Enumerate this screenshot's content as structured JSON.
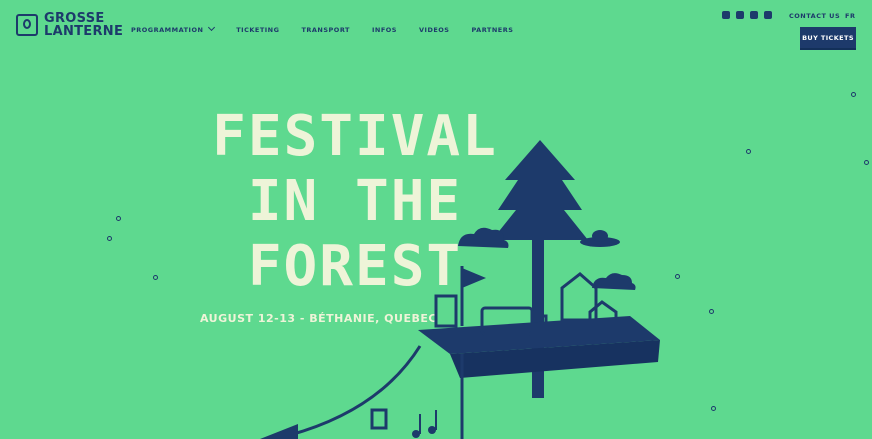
{
  "brand": {
    "line1": "GROSSE",
    "line2": "LANTERNE"
  },
  "nav": {
    "items": [
      "PROGRAMMATION",
      "TICKETING",
      "TRANSPORT",
      "INFOS",
      "VIDEOS",
      "PARTNERS"
    ]
  },
  "header": {
    "social_icons": [
      "twitter-icon",
      "youtube-icon",
      "facebook-icon",
      "flickr-icon"
    ],
    "contact_label": "CONTACT US",
    "lang_label": "FR",
    "buy_label": "BUY TICKETS"
  },
  "hero": {
    "title_line1": "FESTIVAL",
    "title_line2": "IN THE",
    "title_line3": "FOREST",
    "subtitle": "AUGUST 12-13 - BÉTHANIE, QUEBEC"
  },
  "colors": {
    "background": "#5ed98f",
    "primary": "#1d3a6b",
    "hero_text": "#eef4d8"
  }
}
